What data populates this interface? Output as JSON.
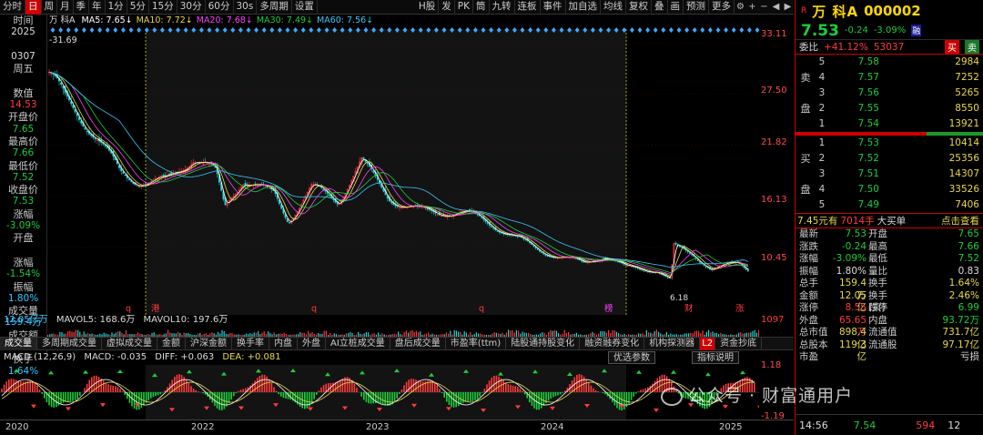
{
  "toolbar": {
    "periods": [
      "分时",
      "日",
      "周",
      "月",
      "季",
      "年",
      "1分",
      "5分",
      "15分",
      "30分",
      "60分",
      "30s",
      "多周期",
      "设置"
    ],
    "active_period": "日",
    "right_buttons": [
      "H股",
      "发",
      "PK",
      "筒",
      "九转",
      "连板",
      "事件",
      "加自选",
      "均线",
      "复权",
      "叠",
      "画",
      "预测",
      "更多"
    ]
  },
  "left_info": [
    {
      "label": "时间",
      "value": "2025",
      "value_color": "white"
    },
    {
      "label": "",
      "value": "0307",
      "value_color": "white"
    },
    {
      "label": "周五",
      "value": "",
      "value_color": "white"
    },
    {
      "label": "数值",
      "value": "14.53",
      "value_color": "red"
    },
    {
      "label": "开盘价",
      "value": "7.65",
      "value_color": "green"
    },
    {
      "label": "最高价",
      "value": "7.66",
      "value_color": "green"
    },
    {
      "label": "最低价",
      "value": "7.52",
      "value_color": "green"
    },
    {
      "label": "收盘价",
      "value": "7.53",
      "value_color": "green"
    },
    {
      "label": "涨幅",
      "value": "-3.09%",
      "value_color": "green"
    },
    {
      "label": "开盘",
      "value": "",
      "value_color": "green"
    },
    {
      "label": "涨幅",
      "value": "-1.54%",
      "value_color": "green"
    },
    {
      "label": "振幅",
      "value": "1.80%",
      "value_color": "cyan"
    },
    {
      "label": "成交量",
      "value": "159.4万",
      "value_color": "cyan"
    },
    {
      "label": "成交额",
      "value": "12.05亿",
      "value_color": "cyan"
    },
    {
      "label": "换手",
      "value": "1.64%",
      "value_color": "cyan"
    }
  ],
  "ma_legend": [
    {
      "label": "MA5: 7.65",
      "color": "#ffffff"
    },
    {
      "label": "MA10: 7.72",
      "color": "#e8d84a"
    },
    {
      "label": "MA20: 7.68",
      "color": "#ff40ff"
    },
    {
      "label": "MA30: 7.49",
      "color": "#1bcf3b"
    },
    {
      "label": "MA60: 7.56",
      "color": "#39c8ff"
    }
  ],
  "stock_short": "万 科A",
  "main_chart": {
    "price_max_label": "-31.69",
    "low_label": "6.18",
    "y_ticks": [
      "33.11",
      "27.50",
      "21.82",
      "16.13",
      "10.45"
    ],
    "event_marks": [
      "q",
      "港",
      "q",
      "q",
      "榜",
      "财",
      "涨"
    ]
  },
  "volume": {
    "head": "12.05亿万",
    "mavol5": "MAVOL5: 168.6万",
    "mavol10": "MAVOL10: 197.6万",
    "y_tick": "1097"
  },
  "tabs": [
    "成交量",
    "多周期成交量",
    "虚拟成交量",
    "金额",
    "沪深金额",
    "换手率",
    "内盘",
    "外盘",
    "AI立桩成交量",
    "盘后成交量",
    "市盈率(ttm)",
    "陆股通持股变化",
    "融资融券变化",
    "机构探测器",
    "资金抄底"
  ],
  "tabs_badge": "L2",
  "macd": {
    "head": "MACD (12,26,9)",
    "macd": "MACD: -0.035",
    "diff": "DIFF: +0.063",
    "dea": "DEA: +0.081",
    "btn_params": "优选参数",
    "btn_help": "指标说明",
    "y_ticks": [
      "1.18",
      "-1.19"
    ]
  },
  "xaxis": [
    "2020",
    "2022",
    "2023",
    "2024",
    "2025"
  ],
  "right": {
    "tag": "R",
    "name": "万 科A",
    "code": "000002",
    "price": "7.53",
    "change": "-0.24",
    "pct": "-3.09%",
    "price_tag": "融",
    "ratio_label": "委比",
    "ratio": "+41.12%",
    "ratio_vol": "53037",
    "buy_btn": "买",
    "sell_btn": "卖",
    "sell_side_chars": [
      "卖",
      "盘"
    ],
    "buy_side_chars": [
      "买",
      "盘"
    ],
    "asks": [
      {
        "n": "5",
        "price": "7.58",
        "vol": "2984"
      },
      {
        "n": "4",
        "price": "7.57",
        "vol": "7252"
      },
      {
        "n": "3",
        "price": "7.56",
        "vol": "5265"
      },
      {
        "n": "2",
        "price": "7.55",
        "vol": "8550"
      },
      {
        "n": "1",
        "price": "7.54",
        "vol": "13921"
      }
    ],
    "bids": [
      {
        "n": "1",
        "price": "7.53",
        "vol": "10414"
      },
      {
        "n": "2",
        "price": "7.52",
        "vol": "25356"
      },
      {
        "n": "3",
        "price": "7.51",
        "vol": "14307"
      },
      {
        "n": "4",
        "price": "7.50",
        "vol": "33526"
      },
      {
        "n": "5",
        "price": "7.49",
        "vol": "7406"
      }
    ],
    "ticker_price": "7.45元有",
    "ticker_vol": "7014手",
    "ticker_text": "大买单",
    "ticker_link": "点击查看",
    "stats": [
      {
        "l1": "最新",
        "v1": "7.53",
        "c1": "green",
        "l2": "开盘",
        "v2": "7.65",
        "c2": "green"
      },
      {
        "l1": "涨跌",
        "v1": "-0.24",
        "c1": "green",
        "l2": "最高",
        "v2": "7.66",
        "c2": "green"
      },
      {
        "l1": "涨幅",
        "v1": "-3.09%",
        "c1": "green",
        "l2": "最低",
        "v2": "7.52",
        "c2": "green"
      },
      {
        "l1": "振幅",
        "v1": "1.80%",
        "c1": "white",
        "l2": "量比",
        "v2": "0.83",
        "c2": "white"
      },
      {
        "l1": "总手",
        "v1": "159.4万",
        "c1": "yellow",
        "l2": "换手",
        "v2": "1.64%",
        "c2": "yellow"
      },
      {
        "l1": "金额",
        "v1": "12.05亿",
        "c1": "yellow",
        "l2": "换手(实)",
        "v2": "2.46%",
        "c2": "yellow"
      },
      {
        "l1": "涨停",
        "v1": "8.55",
        "c1": "red",
        "l2": "跌停",
        "v2": "6.99",
        "c2": "green"
      },
      {
        "l1": "外盘",
        "v1": "65.65万",
        "c1": "red",
        "l2": "内盘",
        "v2": "93.72万",
        "c2": "green"
      },
      {
        "l1": "总市值",
        "v1": "898.4亿",
        "c1": "yellow",
        "l2": "流通值",
        "v2": "731.7亿",
        "c2": "yellow"
      },
      {
        "l1": "总股本",
        "v1": "119.3亿",
        "c1": "yellow",
        "l2": "流通股",
        "v2": "97.17亿",
        "c2": "yellow"
      },
      {
        "l1": "市盈",
        "v1": "",
        "c1": "white",
        "l2": "",
        "v2": "亏损",
        "c2": "white"
      }
    ],
    "trade_time": "14:56",
    "trade_price": "7.54",
    "trade_vol": "594",
    "trade_num": "12"
  },
  "watermark": "公众号 · 财富通用户",
  "colors": {
    "up": "#ff3b3b",
    "down": "#1bcf3b",
    "accent": "#cc0000",
    "bg": "#000000"
  }
}
